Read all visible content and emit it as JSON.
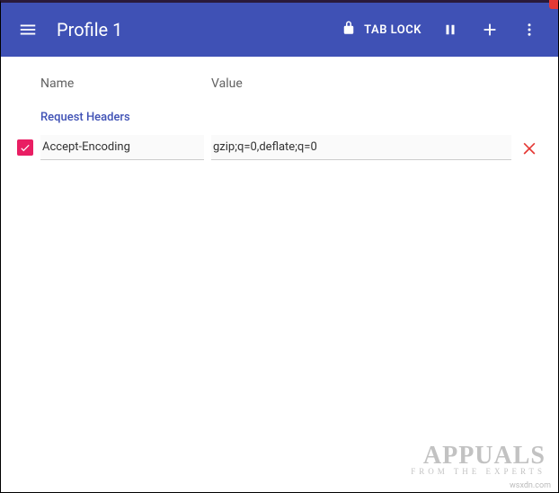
{
  "appbar": {
    "title": "Profile 1",
    "tab_lock_label": "TAB LOCK"
  },
  "columns": {
    "name": "Name",
    "value": "Value"
  },
  "section": {
    "request_headers": "Request Headers"
  },
  "rows": [
    {
      "checked": true,
      "name": "Accept-Encoding",
      "value": "gzip;q=0,deflate;q=0"
    }
  ],
  "watermark": {
    "site": "wsxdn.com",
    "brand": "APPUALS",
    "tagline": "FROM THE EXPERTS"
  }
}
